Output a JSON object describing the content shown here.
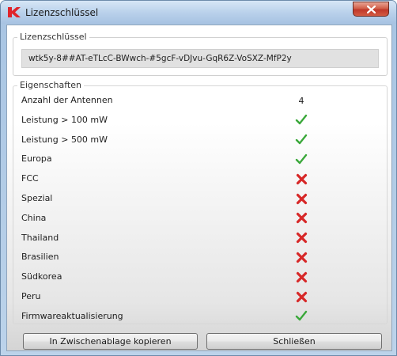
{
  "window": {
    "title": "Lizenzschlüssel",
    "close_glyph": "x"
  },
  "license": {
    "legend": "Lizenzschlüssel",
    "key": "wtk5y-8##AT-eTLcC-BWwch-#5gcF-vDJvu-GqR6Z-VoSXZ-MfP2y"
  },
  "properties": {
    "legend": "Eigenschaften",
    "rows": [
      {
        "label": "Anzahl der Antennen",
        "value": "4",
        "status": "text"
      },
      {
        "label": "Leistung > 100 mW",
        "value": "✓",
        "status": "yes"
      },
      {
        "label": "Leistung > 500 mW",
        "value": "✓",
        "status": "yes"
      },
      {
        "label": "Europa",
        "value": "✓",
        "status": "yes"
      },
      {
        "label": "FCC",
        "value": "✗",
        "status": "no"
      },
      {
        "label": "Spezial",
        "value": "✗",
        "status": "no"
      },
      {
        "label": "China",
        "value": "✗",
        "status": "no"
      },
      {
        "label": "Thailand",
        "value": "✗",
        "status": "no"
      },
      {
        "label": "Brasilien",
        "value": "✗",
        "status": "no"
      },
      {
        "label": "Südkorea",
        "value": "✗",
        "status": "no"
      },
      {
        "label": "Peru",
        "value": "✗",
        "status": "no"
      },
      {
        "label": "Firmwareaktualisierung",
        "value": "✓",
        "status": "yes"
      }
    ]
  },
  "buttons": {
    "copy_label": "In Zwischenablage kopieren",
    "close_label": "Schließen"
  },
  "colors": {
    "check_green": "#3aa83a",
    "cross_red": "#d72828"
  }
}
